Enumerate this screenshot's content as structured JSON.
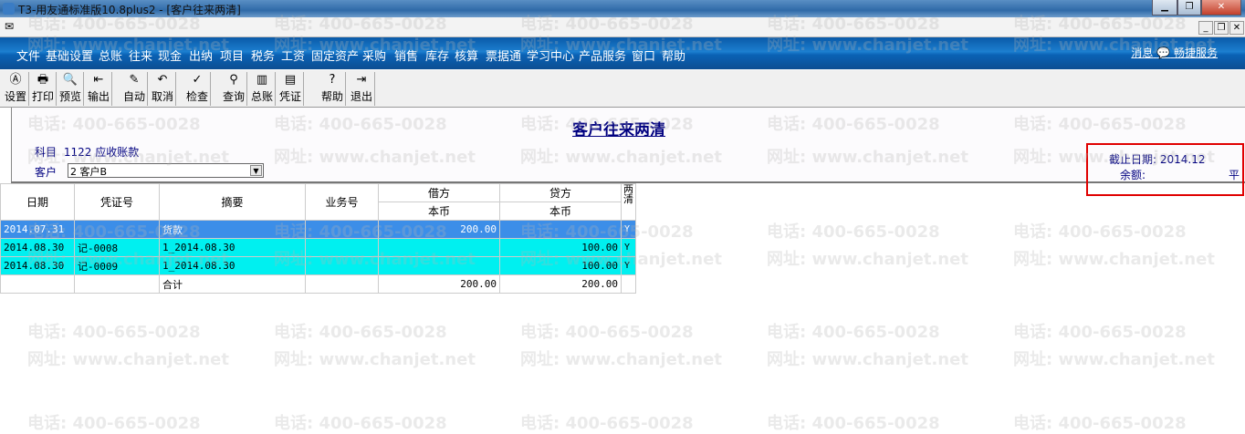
{
  "window": {
    "title": "T3-用友通标准版10.8plus2 - [客户往来两清]"
  },
  "menu": [
    "文件",
    "基础设置",
    "总账",
    "往来",
    "现金",
    "出纳",
    "项目",
    "税务",
    "工资",
    "固定资产",
    "采购",
    "销售",
    "库存",
    "核算",
    "票据通",
    "学习中心",
    "产品服务",
    "窗口",
    "帮助"
  ],
  "menu_right": {
    "messages": "消息",
    "service": "畅捷服务"
  },
  "toolbar": [
    {
      "label": "设置",
      "icon": "setup-icon"
    },
    {
      "label": "打印",
      "icon": "print-icon"
    },
    {
      "label": "预览",
      "icon": "preview-icon"
    },
    {
      "label": "输出",
      "icon": "export-icon"
    },
    {
      "label": "自动",
      "icon": "auto-icon"
    },
    {
      "label": "取消",
      "icon": "undo-icon"
    },
    {
      "label": "检查",
      "icon": "spellcheck-icon"
    },
    {
      "label": "查询",
      "icon": "binoculars-icon"
    },
    {
      "label": "总账",
      "icon": "ledger-icon"
    },
    {
      "label": "凭证",
      "icon": "voucher-icon"
    },
    {
      "label": "帮助",
      "icon": "help-icon"
    },
    {
      "label": "退出",
      "icon": "exit-icon"
    }
  ],
  "report": {
    "title": "客户往来两清",
    "subject_label": "科目",
    "subject_value": "1122 应收账款",
    "customer_label": "客户",
    "customer_value": "2  客户B",
    "end_date_label": "截止日期:",
    "end_date_value": "2014.12",
    "balance_label": "余额:",
    "balance_value": "平"
  },
  "table": {
    "headers": {
      "date": "日期",
      "voucher": "凭证号",
      "summary": "摘要",
      "biz": "业务号",
      "debit": "借方",
      "credit": "贷方",
      "local": "本币",
      "cleared": "两清"
    },
    "rows": [
      {
        "date": "2014.07.31",
        "voucher": "",
        "summary": "货款",
        "biz": "",
        "debit": "200.00",
        "credit": "",
        "cleared": "Y"
      },
      {
        "date": "2014.08.30",
        "voucher": "记-0008",
        "summary": "1_2014.08.30",
        "biz": "",
        "debit": "",
        "credit": "100.00",
        "cleared": "Y"
      },
      {
        "date": "2014.08.30",
        "voucher": "记-0009",
        "summary": "1_2014.08.30",
        "biz": "",
        "debit": "",
        "credit": "100.00",
        "cleared": "Y"
      }
    ],
    "total": {
      "label": "合计",
      "debit": "200.00",
      "credit": "200.00"
    }
  },
  "watermark": {
    "phone": "电话: 400-665-0028",
    "site": "网址: www.chanjet.net"
  }
}
